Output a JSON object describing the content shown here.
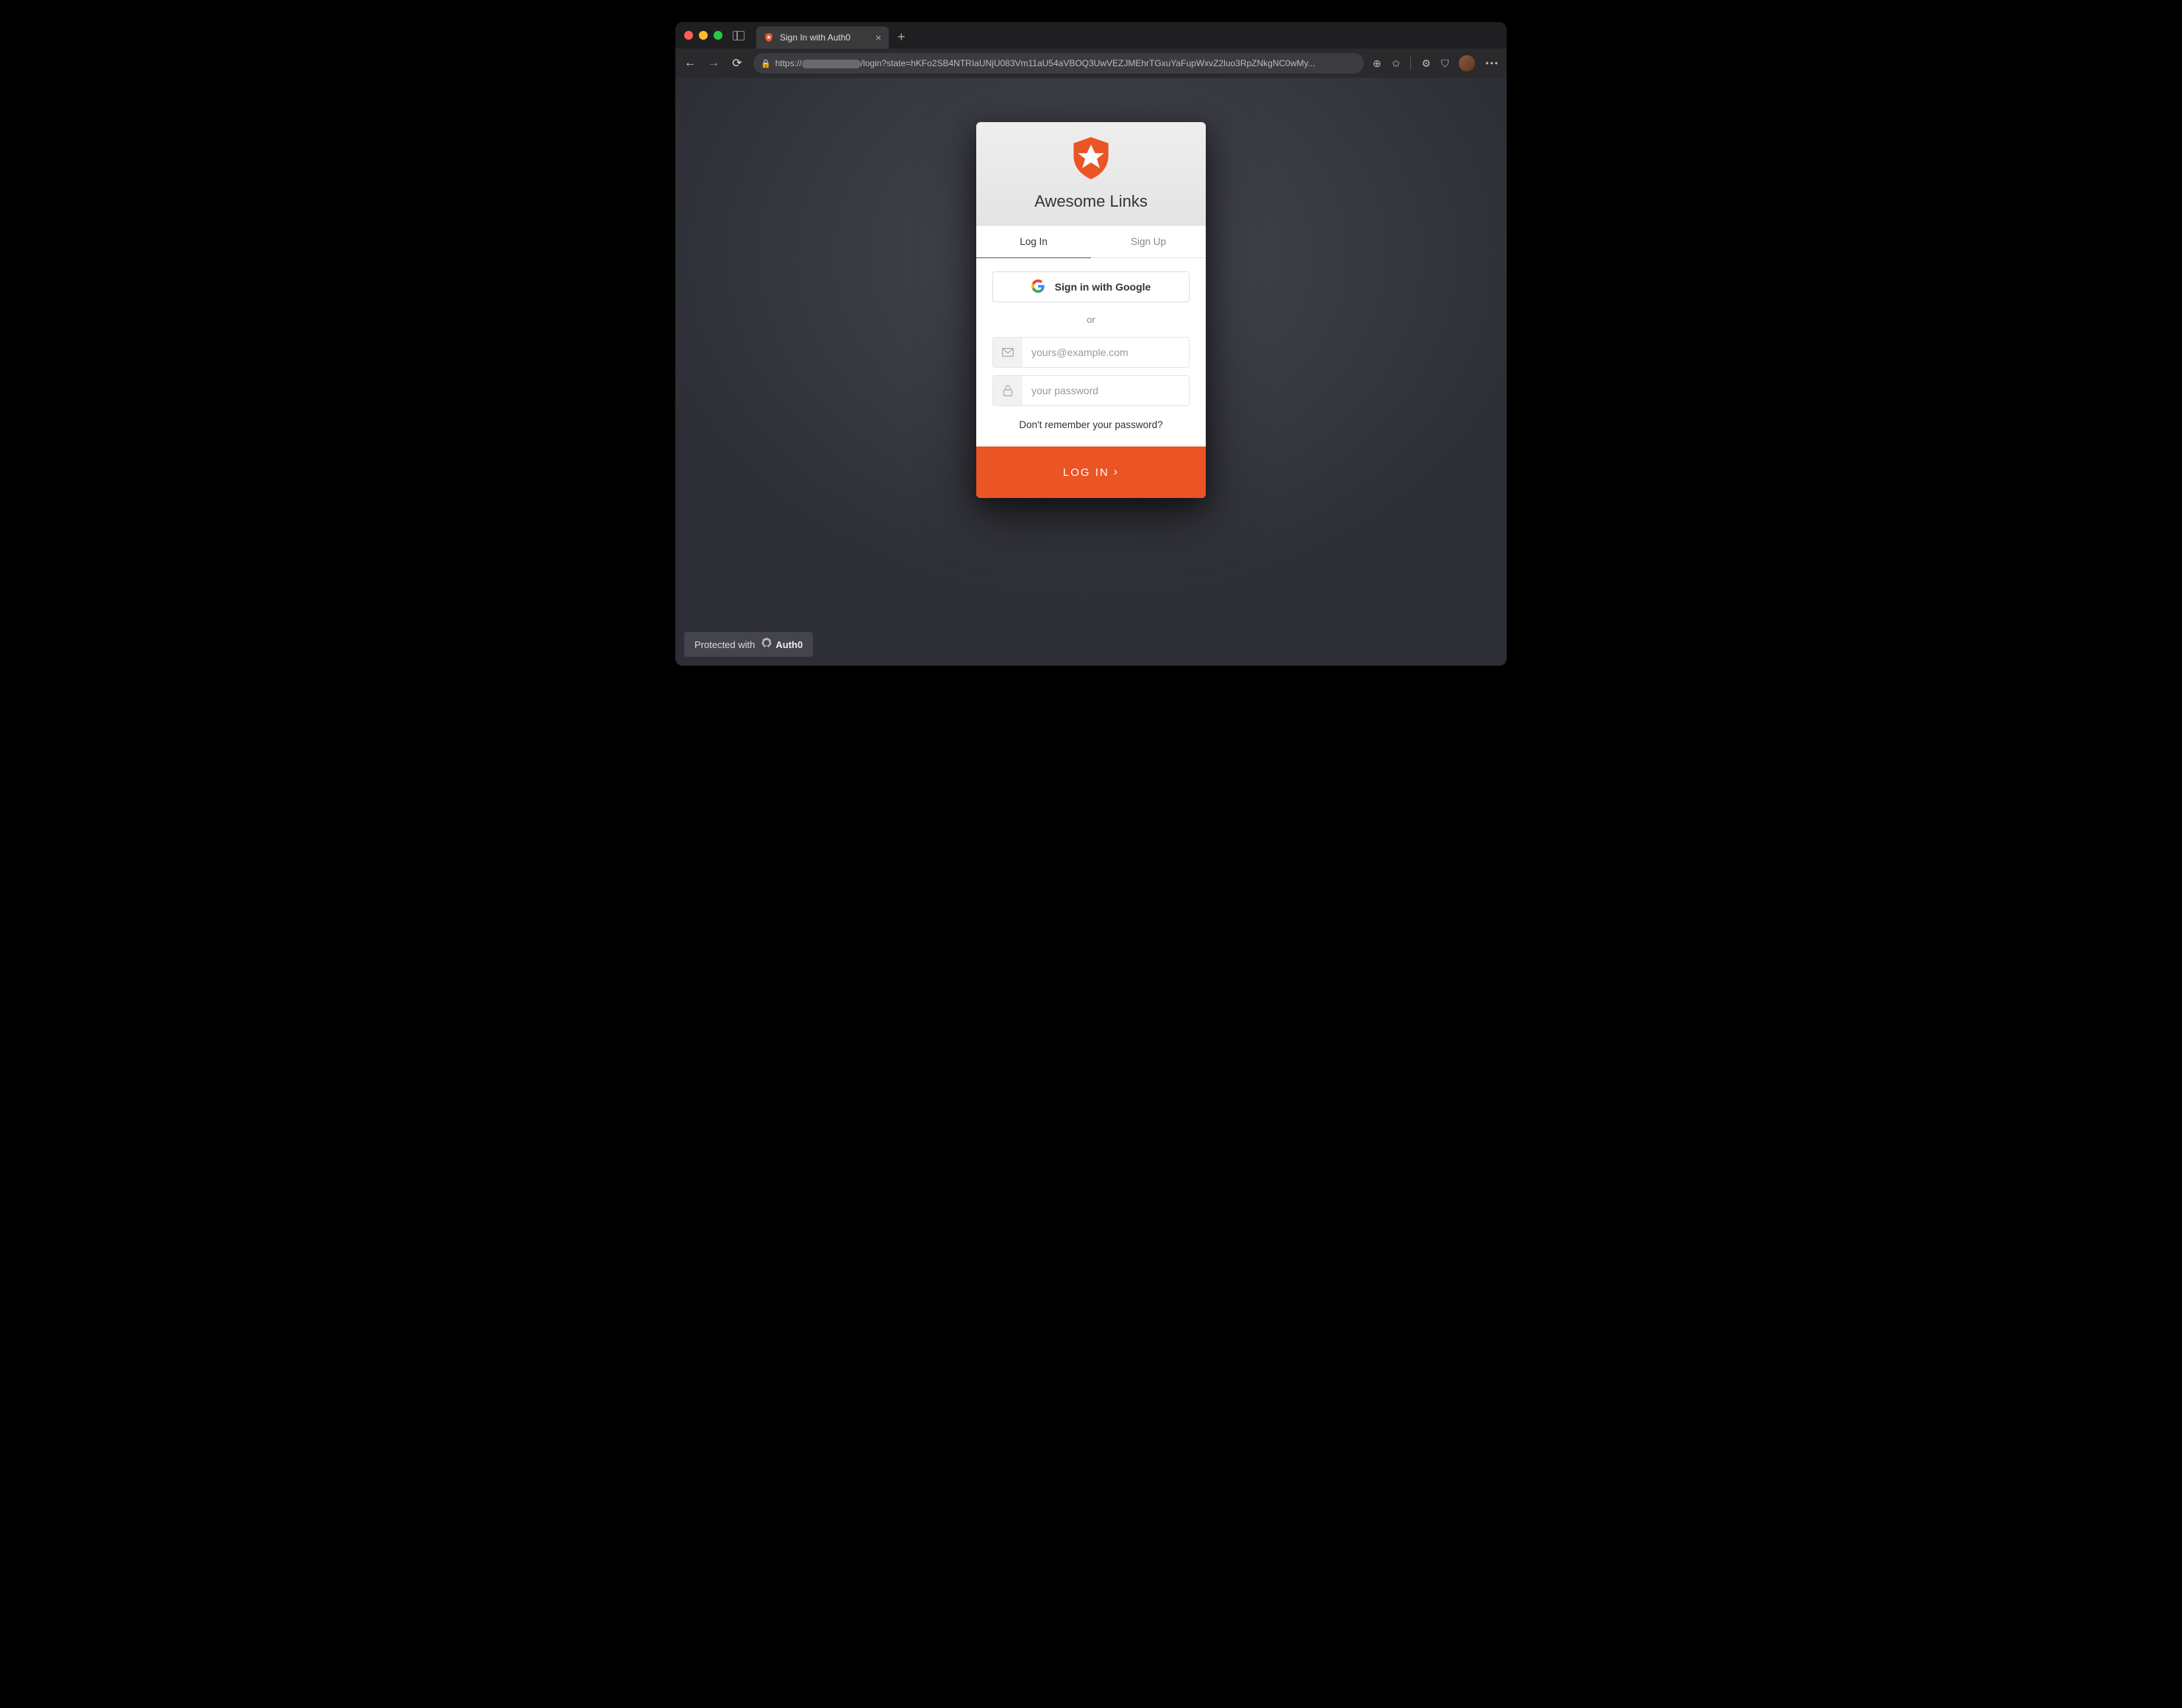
{
  "browser": {
    "tab_title": "Sign In with Auth0",
    "url_prefix": "https://",
    "url_suffix": "/login?state=hKFo2SB4NTRIaUNjU083Vm11aU54aVBOQ3UwVEZJMEhrTGxuYaFupWxvZ2luo3RpZNkgNC0wMy..."
  },
  "auth": {
    "app_title": "Awesome Links",
    "tabs": {
      "login": "Log In",
      "signup": "Sign Up"
    },
    "google_button": "Sign in with Google",
    "or_label": "or",
    "email_placeholder": "yours@example.com",
    "password_placeholder": "your password",
    "forgot_link": "Don't remember your password?",
    "submit_label": "LOG IN"
  },
  "footer": {
    "protected_prefix": "Protected with",
    "brand": "Auth0"
  },
  "colors": {
    "accent": "#eb5424"
  }
}
